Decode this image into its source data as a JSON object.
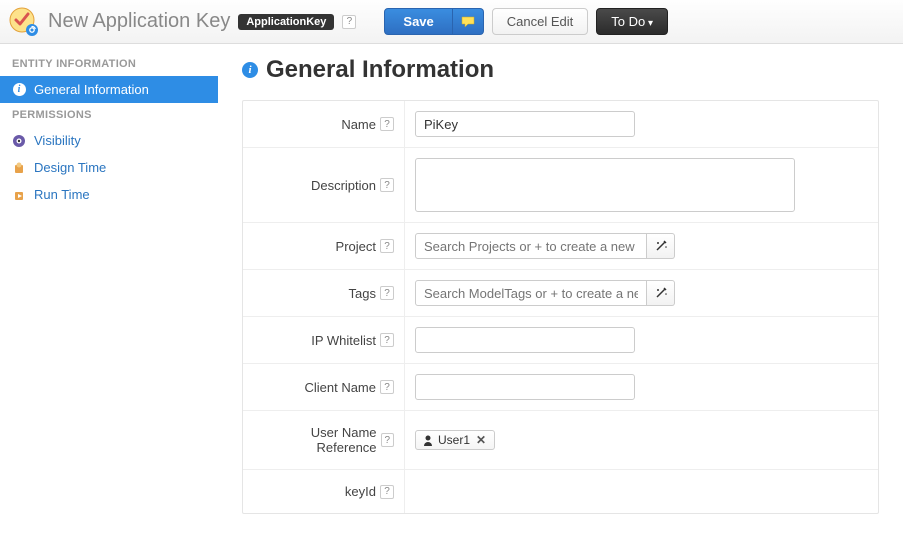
{
  "topbar": {
    "title": "New Application Key",
    "type_badge": "ApplicationKey",
    "save_label": "Save",
    "cancel_label": "Cancel Edit",
    "todo_label": "To Do"
  },
  "sidebar": {
    "section1_header": "ENTITY INFORMATION",
    "section2_header": "PERMISSIONS",
    "items1": [
      {
        "label": "General Information"
      }
    ],
    "items2": [
      {
        "label": "Visibility"
      },
      {
        "label": "Design Time"
      },
      {
        "label": "Run Time"
      }
    ]
  },
  "content": {
    "section_title": "General Information",
    "fields": {
      "name_label": "Name",
      "name_value": "PiKey",
      "description_label": "Description",
      "description_value": "",
      "project_label": "Project",
      "project_placeholder": "Search Projects or + to create a new one",
      "tags_label": "Tags",
      "tags_placeholder": "Search ModelTags or + to create a new one",
      "ipwhitelist_label": "IP Whitelist",
      "ipwhitelist_value": "",
      "clientname_label": "Client Name",
      "clientname_value": "",
      "userref_label": "User Name Reference",
      "userref_value": "User1",
      "keyid_label": "keyId",
      "keyid_value": ""
    }
  }
}
